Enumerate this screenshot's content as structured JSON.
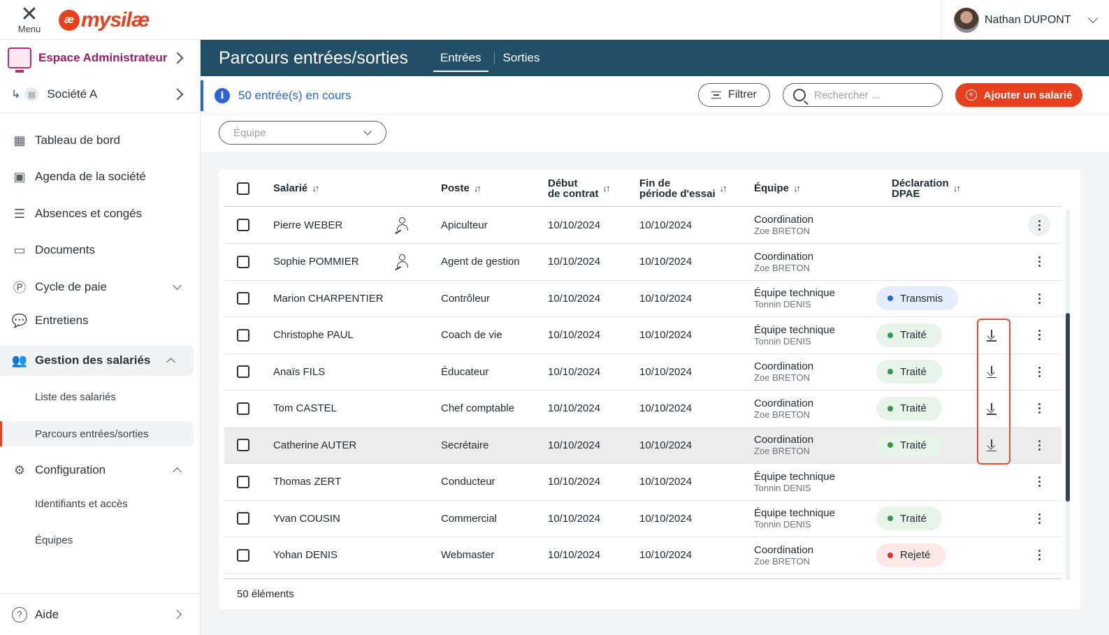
{
  "topbar": {
    "menu_label": "Menu",
    "logo_mark": "æ",
    "logo_text": "mysilæ",
    "user_name": "Nathan DUPONT"
  },
  "sidebar": {
    "admin_label": "Espace Administrateur",
    "company_label": "Société A",
    "items": [
      {
        "label": "Tableau de bord",
        "icon": "dashboard-icon"
      },
      {
        "label": "Agenda de la société",
        "icon": "calendar-icon"
      },
      {
        "label": "Absences et congés",
        "icon": "list-icon"
      },
      {
        "label": "Documents",
        "icon": "folder-icon"
      },
      {
        "label": "Cycle de paie",
        "icon": "payroll-icon"
      },
      {
        "label": "Entretiens",
        "icon": "chat-icon"
      },
      {
        "label": "Gestion des salariés",
        "icon": "users-icon"
      },
      {
        "label": "Configuration",
        "icon": "config-icon"
      }
    ],
    "sub_gestion": [
      "Liste des salariés",
      "Parcours entrées/sorties"
    ],
    "sub_config": [
      "Identifiants et accès",
      "Équipes"
    ],
    "help_label": "Aide"
  },
  "header": {
    "title": "Parcours entrées/sorties",
    "tabs": [
      "Entrées",
      "Sorties"
    ]
  },
  "toolbar": {
    "info_text": "50 entrée(s) en cours",
    "filter_label": "Filtrer",
    "search_placeholder": "Rechercher ...",
    "add_label": "Ajouter un salarié"
  },
  "filters": {
    "team_placeholder": "Équipe"
  },
  "table": {
    "columns": {
      "salarie": "Salarié",
      "poste": "Poste",
      "debut_1": "Début",
      "debut_2": "de contrat",
      "fin_1": "Fin de",
      "fin_2": "période d'essai",
      "equipe": "Équipe",
      "dpae_1": "Déclaration",
      "dpae_2": "DPAE"
    },
    "sort_glyph": "↓↑",
    "rows": [
      {
        "name": "Pierre WEBER",
        "poste": "Apiculteur",
        "debut": "10/10/2024",
        "fin": "10/10/2024",
        "equipe": "Coordination",
        "manager": "Zoe BRETON",
        "dpae": ""
      },
      {
        "name": "Sophie POMMIER",
        "poste": "Agent de gestion",
        "debut": "10/10/2024",
        "fin": "10/10/2024",
        "equipe": "Coordination",
        "manager": "Zoe BRETON",
        "dpae": ""
      },
      {
        "name": "Marion CHARPENTIER",
        "poste": "Contrôleur",
        "debut": "10/10/2024",
        "fin": "10/10/2024",
        "equipe": "Équipe technique",
        "manager": "Tonnin DENIS",
        "dpae": "Transmis"
      },
      {
        "name": "Christophe PAUL",
        "poste": "Coach de vie",
        "debut": "10/10/2024",
        "fin": "10/10/2024",
        "equipe": "Équipe technique",
        "manager": "Tonnin DENIS",
        "dpae": "Traité"
      },
      {
        "name": "Anaïs FILS",
        "poste": "Éducateur",
        "debut": "10/10/2024",
        "fin": "10/10/2024",
        "equipe": "Coordination",
        "manager": "Zoe BRETON",
        "dpae": "Traité"
      },
      {
        "name": "Tom CASTEL",
        "poste": "Chef comptable",
        "debut": "10/10/2024",
        "fin": "10/10/2024",
        "equipe": "Coordination",
        "manager": "Zoe BRETON",
        "dpae": "Traité"
      },
      {
        "name": "Catherine AUTER",
        "poste": "Secrétaire",
        "debut": "10/10/2024",
        "fin": "10/10/2024",
        "equipe": "Coordination",
        "manager": "Zoe BRETON",
        "dpae": "Traité"
      },
      {
        "name": "Thomas ZERT",
        "poste": "Conducteur",
        "debut": "10/10/2024",
        "fin": "10/10/2024",
        "equipe": "Équipe technique",
        "manager": "Tonnin DENIS",
        "dpae": ""
      },
      {
        "name": "Yvan COUSIN",
        "poste": "Commercial",
        "debut": "10/10/2024",
        "fin": "10/10/2024",
        "equipe": "Équipe technique",
        "manager": "Tonnin DENIS",
        "dpae": "Traité"
      },
      {
        "name": "Yohan DENIS",
        "poste": "Webmaster",
        "debut": "10/10/2024",
        "fin": "10/10/2024",
        "equipe": "Coordination",
        "manager": "Zoe BRETON",
        "dpae": "Rejeté"
      }
    ],
    "footer": "50 éléments"
  },
  "colors": {
    "brand": "#e8401c",
    "header": "#234e67",
    "info": "#2a64d6",
    "transmis_bg": "#e5ecfb",
    "transmis_dot": "#2a64d6",
    "traite_bg": "#e8f3ea",
    "traite_dot": "#2f9a4b",
    "rejete_bg": "#fde8e8",
    "rejete_dot": "#e02d2d"
  }
}
